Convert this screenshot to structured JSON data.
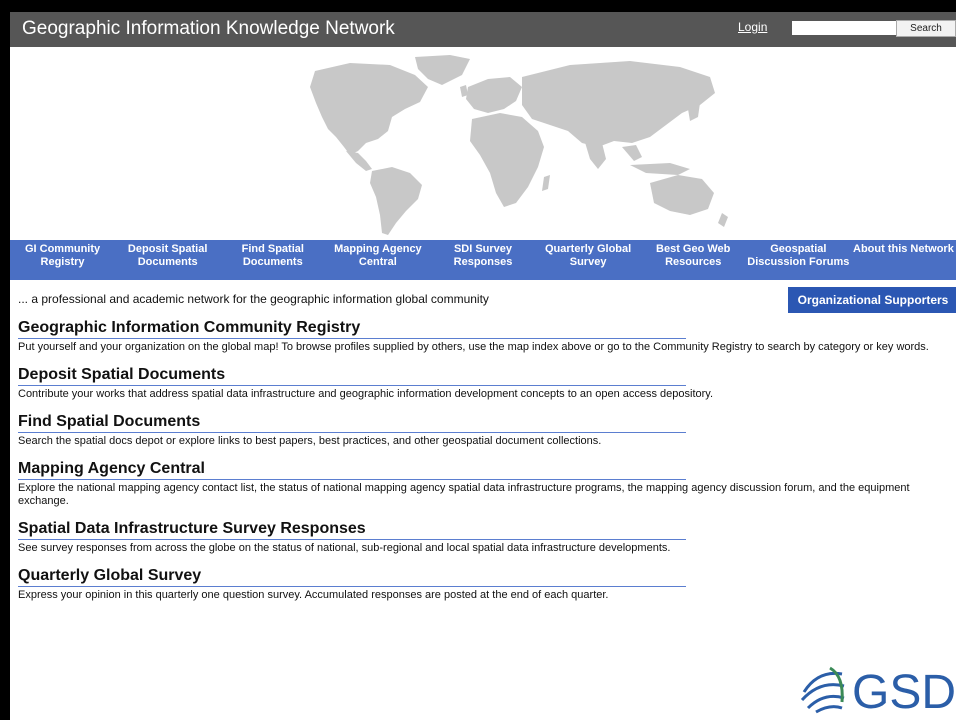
{
  "header": {
    "title": "Geographic Information Knowledge Network",
    "login_label": "Login",
    "search_button_label": "Search",
    "search_value": ""
  },
  "nav": {
    "items": [
      {
        "label": "GI Community Registry"
      },
      {
        "label": "Deposit Spatial Documents"
      },
      {
        "label": "Find Spatial Documents"
      },
      {
        "label": "Mapping Agency Central"
      },
      {
        "label": "SDI Survey Responses"
      },
      {
        "label": "Quarterly Global Survey"
      },
      {
        "label": "Best Geo Web Resources"
      },
      {
        "label": "Geospatial Discussion Forums"
      },
      {
        "label": "About this Network"
      }
    ]
  },
  "tagline": "... a professional and academic network for the geographic information global community",
  "supporters_label": "Organizational Supporters",
  "sections": [
    {
      "title": "Geographic Information Community Registry",
      "desc": "Put yourself and your organization on the global map! To browse profiles supplied by others, use the map index above or go to the Community Registry to search by category or key words."
    },
    {
      "title": "Deposit Spatial Documents",
      "desc": "Contribute your works that address spatial data infrastructure and geographic information development concepts to an open access depository."
    },
    {
      "title": "Find Spatial Documents",
      "desc": "Search the spatial docs depot or explore links to best papers, best practices, and other geospatial document collections."
    },
    {
      "title": "Mapping Agency Central",
      "desc": "Explore the national mapping agency contact list, the status of national mapping agency spatial data infrastructure programs, the mapping agency discussion forum, and the equipment exchange."
    },
    {
      "title": "Spatial Data Infrastructure Survey Responses",
      "desc": "See survey responses from across the globe on the status of national, sub-regional and local spatial data infrastructure developments."
    },
    {
      "title": "Quarterly Global Survey",
      "desc": "Express your opinion in this quarterly one question survey. Accumulated responses are posted at the end of each quarter."
    }
  ],
  "logo": {
    "text": "GSD",
    "color": "#2b5ea8",
    "accent": "#3b8a57"
  },
  "colors": {
    "header_bg": "#565656",
    "nav_bg": "#4a6fc4",
    "supporters_bg": "#2b57b3",
    "map_land": "#c8c8c8"
  }
}
